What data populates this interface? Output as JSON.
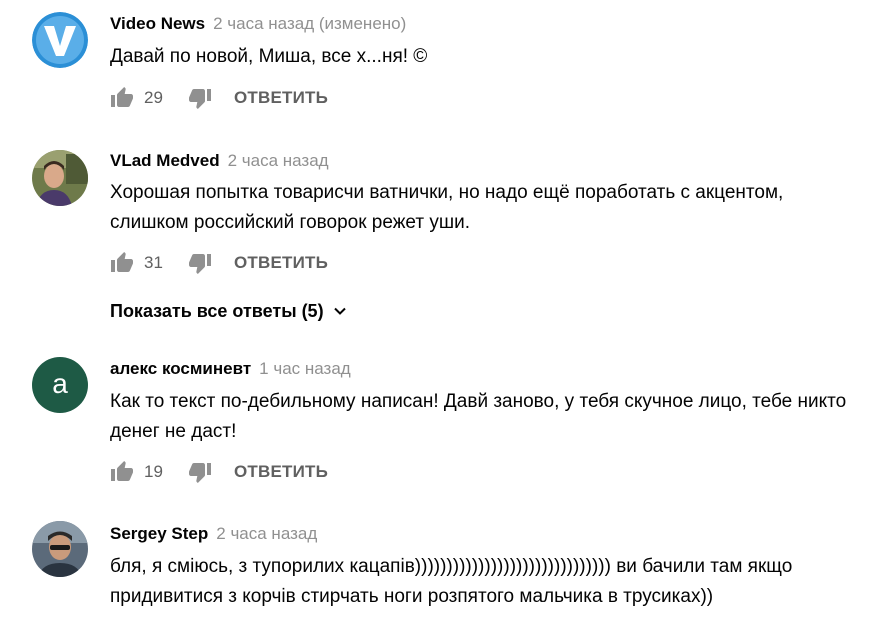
{
  "comments": [
    {
      "author": "Video News",
      "time": "2 часа назад (изменено)",
      "text": "Давай по новой, Миша, все х...ня! ©",
      "likes": "29",
      "reply_label": "ОТВЕТИТЬ",
      "avatar_color": "#2b8fd6"
    },
    {
      "author": "VLad Medved",
      "time": "2 часа назад",
      "text": "Хорошая попытка товарисчи ватнички, но надо ещё поработать с акцентом, слишком российский говорок режет уши.",
      "likes": "31",
      "reply_label": "ОТВЕТИТЬ"
    },
    {
      "author": "алекс косминевт",
      "time": "1 час назад",
      "text": "Как то текст по-дебильному написан! Давй заново, у тебя скучное лицо, тебе никто денег не даст!",
      "likes": "19",
      "reply_label": "ОТВЕТИТЬ",
      "avatar_letter": "а",
      "avatar_color": "#1e5a45"
    },
    {
      "author": "Sergey Step",
      "time": "2 часа назад",
      "text": "бля, я сміюсь, з тупорилих кацапів))))))))))))))))))))))))))))))) ви бачили там якщо придивитися з корчів стирчать ноги розпятого мальчика в трусиках))"
    }
  ],
  "show_replies_label": "Показать все ответы (5)"
}
